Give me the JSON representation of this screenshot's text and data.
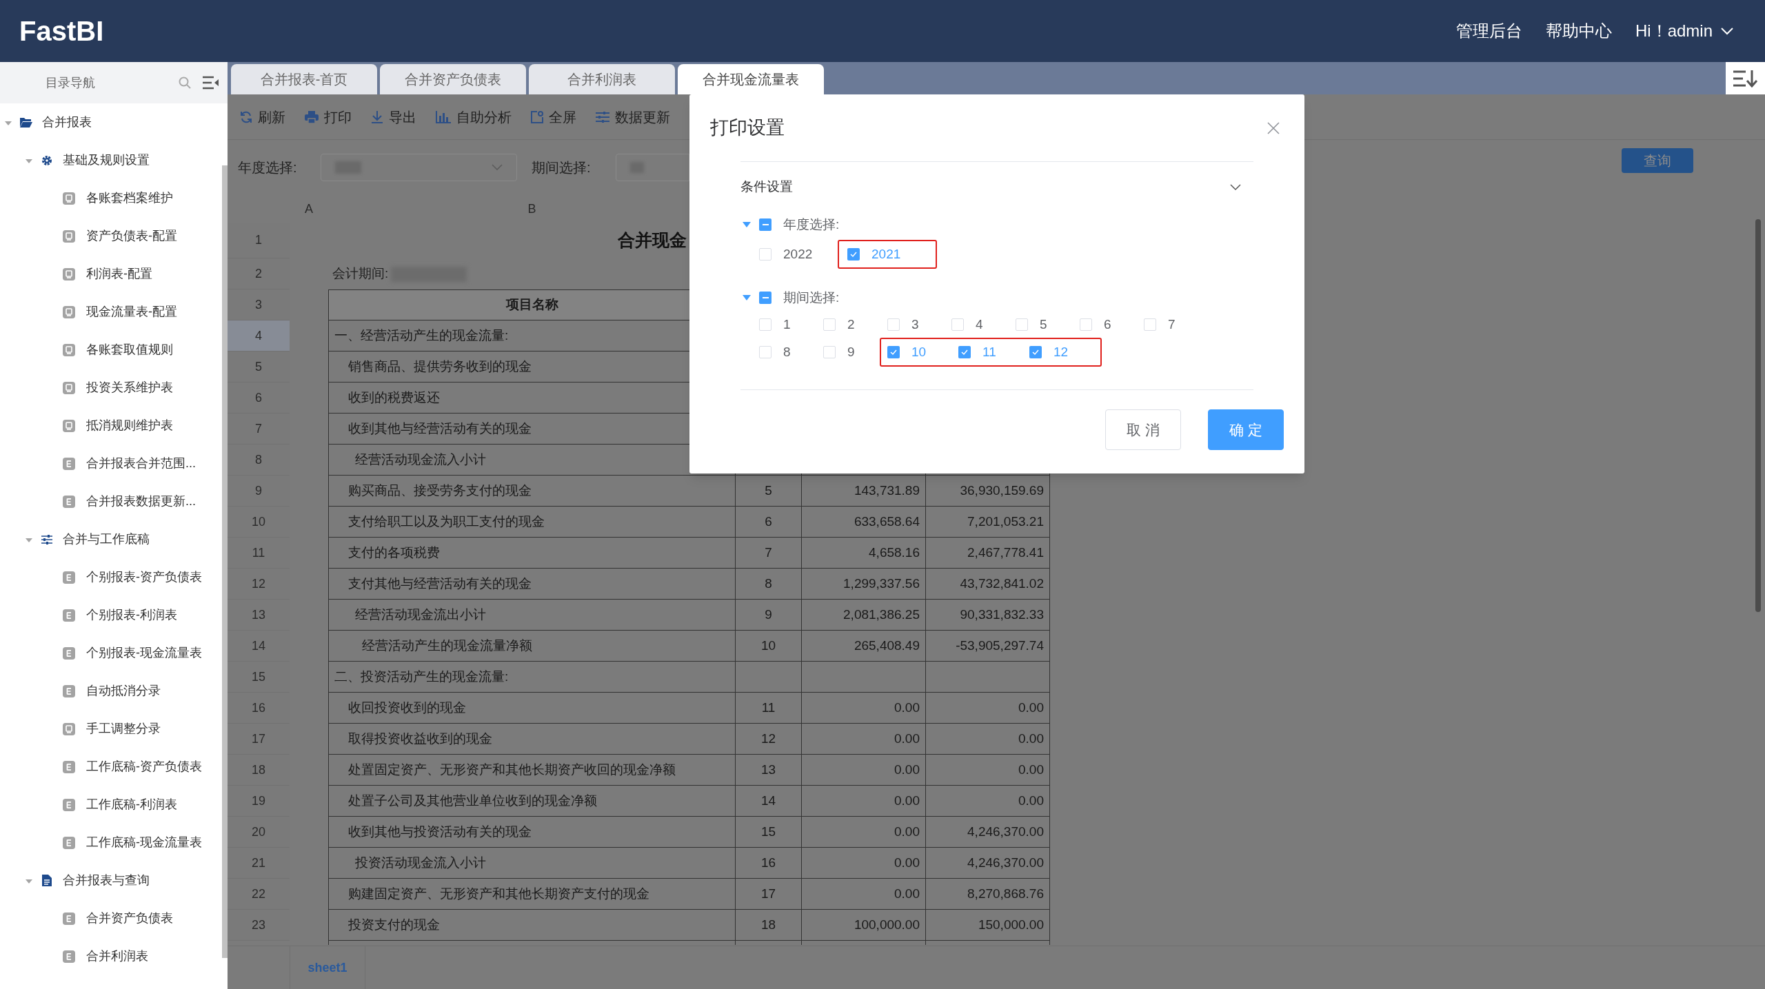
{
  "header": {
    "logo": "FastBI",
    "links": [
      {
        "label": "管理后台"
      },
      {
        "label": "帮助中心"
      }
    ],
    "user": "Hi！admin"
  },
  "sidebar": {
    "title": "目录导航",
    "tree": [
      {
        "label": "合并报表",
        "kind": "folder",
        "expanded": true,
        "children": [
          {
            "label": "基础及规则设置",
            "kind": "settings",
            "expanded": true,
            "children": [
              {
                "label": "各账套档案维护",
                "kind": "screen"
              },
              {
                "label": "资产负债表-配置",
                "kind": "screen"
              },
              {
                "label": "利润表-配置",
                "kind": "screen"
              },
              {
                "label": "现金流量表-配置",
                "kind": "screen"
              },
              {
                "label": "各账套取值规则",
                "kind": "screen"
              },
              {
                "label": "投资关系维护表",
                "kind": "screen"
              },
              {
                "label": "抵消规则维护表",
                "kind": "screen"
              },
              {
                "label": "合并报表合并范围...",
                "kind": "sheet"
              },
              {
                "label": "合并报表数据更新...",
                "kind": "sheet"
              }
            ]
          },
          {
            "label": "合并与工作底稿",
            "kind": "filters",
            "expanded": true,
            "children": [
              {
                "label": "个别报表-资产负债表",
                "kind": "sheet"
              },
              {
                "label": "个别报表-利润表",
                "kind": "sheet"
              },
              {
                "label": "个别报表-现金流量表",
                "kind": "sheet"
              },
              {
                "label": "自动抵消分录",
                "kind": "sheet"
              },
              {
                "label": "手工调整分录",
                "kind": "screen"
              },
              {
                "label": "工作底稿-资产负债表",
                "kind": "sheet"
              },
              {
                "label": "工作底稿-利润表",
                "kind": "sheet"
              },
              {
                "label": "工作底稿-现金流量表",
                "kind": "sheet"
              }
            ]
          },
          {
            "label": "合并报表与查询",
            "kind": "document",
            "expanded": true,
            "children": [
              {
                "label": "合并资产负债表",
                "kind": "sheet"
              },
              {
                "label": "合并利润表",
                "kind": "sheet"
              }
            ]
          }
        ]
      }
    ]
  },
  "tabs": [
    {
      "label": "合并报表-首页",
      "selected": false
    },
    {
      "label": "合并资产负债表",
      "selected": false
    },
    {
      "label": "合并利润表",
      "selected": false
    },
    {
      "label": "合并现金流量表",
      "selected": true
    }
  ],
  "toolbar": [
    {
      "label": "刷新",
      "kind": "refresh"
    },
    {
      "label": "打印",
      "kind": "print"
    },
    {
      "label": "导出",
      "kind": "export"
    },
    {
      "label": "自助分析",
      "kind": "chart"
    },
    {
      "label": "全屏",
      "kind": "fullscreen"
    },
    {
      "label": "数据更新",
      "kind": "sliders"
    }
  ],
  "filters": [
    {
      "label": "年度选择:"
    },
    {
      "label": "期间选择:"
    }
  ],
  "query_button": "查询",
  "sheet": {
    "columns": [
      "A",
      "B"
    ],
    "rows": [
      {
        "number": "1",
        "kind": "title",
        "name": "合并现金",
        "selected": false
      },
      {
        "number": "2",
        "kind": "period",
        "name": "会计期间:",
        "selected": false
      },
      {
        "number": "3",
        "kind": "header",
        "name": "项目名称",
        "selected": false
      },
      {
        "number": "4",
        "kind": "section",
        "name": "一、经营活动产生的现金流量:",
        "selected": true
      },
      {
        "number": "5",
        "kind": "item",
        "name": "销售商品、提供劳务收到的现金",
        "selected": false
      },
      {
        "number": "6",
        "kind": "item",
        "name": "收到的税费返还",
        "selected": false
      },
      {
        "number": "7",
        "kind": "item",
        "name": "收到其他与经营活动有关的现金",
        "selected": false
      },
      {
        "number": "8",
        "kind": "subtotal",
        "name": "经营活动现金流入小计",
        "selected": false
      },
      {
        "number": "9",
        "kind": "item",
        "name": "购买商品、接受劳务支付的现金",
        "line": "5",
        "current": "143,731.89",
        "cumulative": "36,930,159.69",
        "selected": false
      },
      {
        "number": "10",
        "kind": "item",
        "name": "支付给职工以及为职工支付的现金",
        "line": "6",
        "current": "633,658.64",
        "cumulative": "7,201,053.21",
        "selected": false
      },
      {
        "number": "11",
        "kind": "item",
        "name": "支付的各项税费",
        "line": "7",
        "current": "4,658.16",
        "cumulative": "2,467,778.41",
        "selected": false
      },
      {
        "number": "12",
        "kind": "item",
        "name": "支付其他与经营活动有关的现金",
        "line": "8",
        "current": "1,299,337.56",
        "cumulative": "43,732,841.02",
        "selected": false
      },
      {
        "number": "13",
        "kind": "subtotal",
        "name": "经营活动现金流出小计",
        "line": "9",
        "current": "2,081,386.25",
        "cumulative": "90,331,832.33",
        "selected": false
      },
      {
        "number": "14",
        "kind": "total",
        "name": "经营活动产生的现金流量净额",
        "line": "10",
        "current": "265,408.49",
        "cumulative": "-53,905,297.74",
        "selected": false
      },
      {
        "number": "15",
        "kind": "section",
        "name": "二、投资活动产生的现金流量:",
        "selected": false
      },
      {
        "number": "16",
        "kind": "item",
        "name": "收回投资收到的现金",
        "line": "11",
        "current": "0.00",
        "cumulative": "0.00",
        "selected": false
      },
      {
        "number": "17",
        "kind": "item",
        "name": "取得投资收益收到的现金",
        "line": "12",
        "current": "0.00",
        "cumulative": "0.00",
        "selected": false
      },
      {
        "number": "18",
        "kind": "item",
        "name": "处置固定资产、无形资产和其他长期资产收回的现金净额",
        "line": "13",
        "current": "0.00",
        "cumulative": "0.00",
        "selected": false
      },
      {
        "number": "19",
        "kind": "item",
        "name": "处置子公司及其他营业单位收到的现金净额",
        "line": "14",
        "current": "0.00",
        "cumulative": "0.00",
        "selected": false
      },
      {
        "number": "20",
        "kind": "item",
        "name": "收到其他与投资活动有关的现金",
        "line": "15",
        "current": "0.00",
        "cumulative": "4,246,370.00",
        "selected": false
      },
      {
        "number": "21",
        "kind": "subtotal",
        "name": "投资活动现金流入小计",
        "line": "16",
        "current": "0.00",
        "cumulative": "4,246,370.00",
        "selected": false
      },
      {
        "number": "22",
        "kind": "item",
        "name": "购建固定资产、无形资产和其他长期资产支付的现金",
        "line": "17",
        "current": "0.00",
        "cumulative": "8,270,868.76",
        "selected": false
      },
      {
        "number": "23",
        "kind": "item",
        "name": "投资支付的现金",
        "line": "18",
        "current": "100,000.00",
        "cumulative": "150,000.00",
        "selected": false
      }
    ],
    "sheet_tabs": [
      {
        "label": "sheet1",
        "selected": true
      }
    ]
  },
  "modal": {
    "title": "打印设置",
    "section": {
      "label": "条件设置",
      "expanded": true
    },
    "groups": [
      {
        "label": "年度选择:",
        "expanded": true,
        "indeterminate": true,
        "rows": [
          [
            {
              "label": "2022",
              "checked": false,
              "highlighted": false
            },
            {
              "label": "2021",
              "checked": true,
              "highlighted": true
            }
          ]
        ]
      },
      {
        "label": "期间选择:",
        "expanded": true,
        "indeterminate": true,
        "rows": [
          [
            {
              "label": "1",
              "checked": false,
              "highlighted": false
            },
            {
              "label": "2",
              "checked": false,
              "highlighted": false
            },
            {
              "label": "3",
              "checked": false,
              "highlighted": false
            },
            {
              "label": "4",
              "checked": false,
              "highlighted": false
            },
            {
              "label": "5",
              "checked": false,
              "highlighted": false
            },
            {
              "label": "6",
              "checked": false,
              "highlighted": false
            },
            {
              "label": "7",
              "checked": false,
              "highlighted": false
            }
          ],
          [
            {
              "label": "8",
              "checked": false,
              "highlighted": false
            },
            {
              "label": "9",
              "checked": false,
              "highlighted": false
            },
            {
              "label": "10",
              "checked": true,
              "highlighted": true
            },
            {
              "label": "11",
              "checked": true,
              "highlighted": true
            },
            {
              "label": "12",
              "checked": true,
              "highlighted": true
            }
          ]
        ]
      }
    ],
    "buttons": [
      {
        "label": "取 消",
        "kind": "secondary"
      },
      {
        "label": "确 定",
        "kind": "primary"
      }
    ]
  }
}
